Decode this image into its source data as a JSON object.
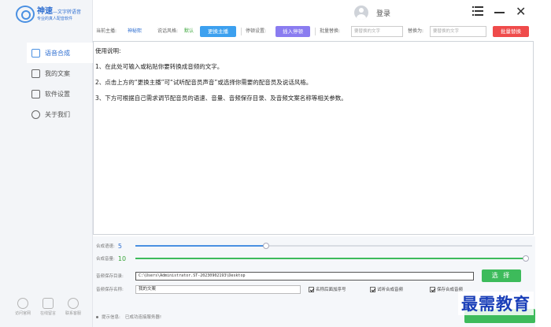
{
  "app": {
    "name": "神速",
    "name_suffix": "—文字转语音",
    "tagline": "专业的真人配音软件"
  },
  "header": {
    "login_label": "登录"
  },
  "sidebar": {
    "items": [
      {
        "label": "语音合成",
        "icon": "voice-synthesis-icon",
        "active": true
      },
      {
        "label": "我的文案",
        "icon": "document-icon",
        "active": false
      },
      {
        "label": "软件设置",
        "icon": "settings-sliders-icon",
        "active": false
      },
      {
        "label": "关于我们",
        "icon": "info-icon",
        "active": false
      }
    ],
    "bottom_buttons": [
      {
        "label": "访问官网",
        "icon": "globe-icon"
      },
      {
        "label": "在线留言",
        "icon": "edit-icon"
      },
      {
        "label": "联系客服",
        "icon": "headset-icon"
      }
    ]
  },
  "toolbar": {
    "anchor_label": "当前主播:",
    "anchor_value": "神秘熙",
    "style_label": "说话风格:",
    "style_value": "默认",
    "change_anchor_button": "更换主播",
    "pause_label": "停顿设置:",
    "insert_pause_button": "插入停顿",
    "batch_replace_label": "批量替换:",
    "batch_replace_placeholder": "要替换的文字",
    "replace_with_label": "替换为:",
    "replace_with_placeholder": "要替换的文字",
    "batch_replace_button": "批量替换"
  },
  "editor": {
    "lines": [
      "使用说明:",
      "1、在此处可输入或粘贴你要转换成音频的文字。",
      "2、点击上方的“更换主播”可“试听配音员声音”或选择你需要的配音员及说话风格。",
      "3、下方可根据自己需求调节配音员的语速、音量、音频保存目录、及音频文案名称等相关参数。"
    ]
  },
  "controls": {
    "speed_label": "合成语速:",
    "speed_value": "5",
    "speed_fraction": 0.33,
    "volume_label": "合成音量:",
    "volume_value": "10",
    "volume_fraction": 1.0,
    "save_dir_label": "音频保存目录:",
    "save_dir_value": "C:\\Users\\Administrator.ST-20230902193\\Desktop",
    "choose_button": "选 择",
    "save_name_label": "音频保存名称:",
    "save_name_value": "我的文案",
    "checkboxes": [
      {
        "label": "名称后面加序号",
        "checked": true
      },
      {
        "label": "试听合成音频",
        "checked": true
      },
      {
        "label": "保存合成音频",
        "checked": true
      }
    ],
    "status_label": "提示信息:",
    "status_value": "已成功连接服务器!"
  },
  "watermark": "最需教育",
  "colors": {
    "accent_blue": "#4a90e2",
    "change_btn": "#3ca0ef",
    "insert_btn": "#8a7cf0",
    "batch_btn": "#ef4b4b",
    "green": "#3dbb5b",
    "speed_fill": "#4a90e2",
    "volume_fill": "#3dbb5b"
  }
}
